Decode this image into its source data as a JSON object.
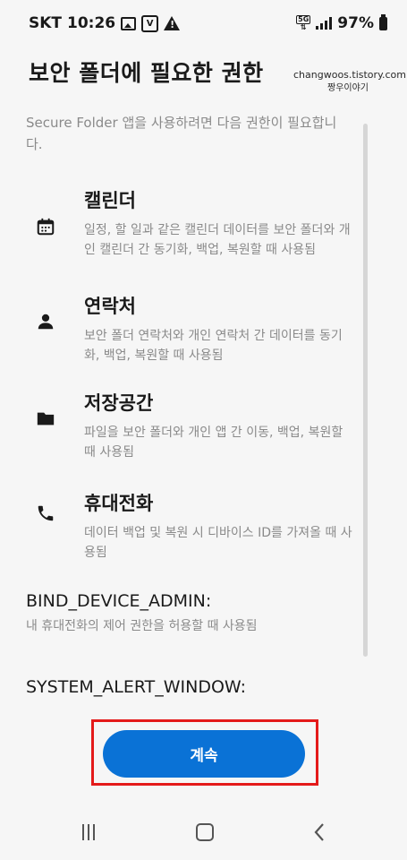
{
  "status_bar": {
    "carrier": "SKT",
    "time": "10:26",
    "network_badge": "5G",
    "battery": "97%",
    "icons": [
      "image-icon",
      "v-icon",
      "warning-icon",
      "5g-icon",
      "signal-icon",
      "battery-icon"
    ]
  },
  "header": {
    "title": "보안 폴더에 필요한 권한"
  },
  "watermark": {
    "line1": "changwoos.tistory.com",
    "line2": "짱우이야기"
  },
  "intro": "Secure Folder 앱을 사용하려면 다음 권한이 필요합니다.",
  "permissions": [
    {
      "icon": "calendar-icon",
      "title": "캘린더",
      "description": "일정, 할 일과 같은 캘린더 데이터를 보안 폴더와 개인 캘린더 간 동기화, 백업, 복원할 때 사용됨"
    },
    {
      "icon": "person-icon",
      "title": "연락처",
      "description": "보안 폴더 연락처와 개인 연락처 간 데이터를 동기화, 백업, 복원할 때 사용됨"
    },
    {
      "icon": "folder-icon",
      "title": "저장공간",
      "description": "파일을 보안 폴더와 개인 앱 간 이동, 백업, 복원할 때 사용됨"
    },
    {
      "icon": "phone-icon",
      "title": "휴대전화",
      "description": "데이터 백업 및 복원 시 디바이스 ID를 가져올 때 사용됨"
    }
  ],
  "system_permissions": [
    {
      "title": "BIND_DEVICE_ADMIN:",
      "description": "내 휴대전화의 제어 권한을 허용할 때 사용됨"
    },
    {
      "title": "SYSTEM_ALERT_WINDOW:",
      "description": ""
    }
  ],
  "continue_button": "계속",
  "highlight_color": "#e41a1a",
  "accent_color": "#0a72d6",
  "nav_bar": {
    "icons": [
      "recent-apps-icon",
      "home-icon",
      "back-icon"
    ]
  }
}
